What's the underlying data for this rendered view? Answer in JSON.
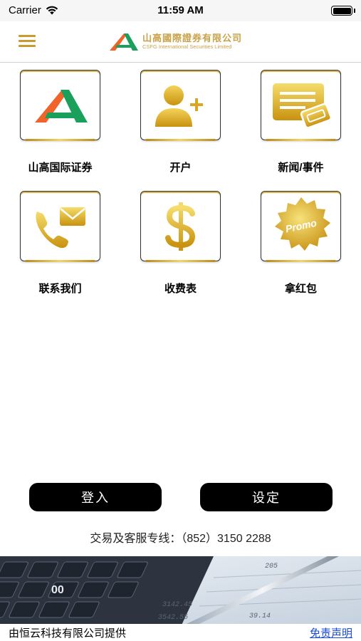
{
  "status_bar": {
    "carrier": "Carrier",
    "time": "11:59 AM"
  },
  "header": {
    "logo_cn": "山高國際證券有限公司",
    "logo_en": "CSFG International Securities Limited"
  },
  "tiles": [
    {
      "label": "山高国际证券",
      "icon": "csfg-logo-icon"
    },
    {
      "label": "开户",
      "icon": "add-user-icon"
    },
    {
      "label": "新闻/事件",
      "icon": "news-icon"
    },
    {
      "label": "联系我们",
      "icon": "contact-icon"
    },
    {
      "label": "收费表",
      "icon": "dollar-icon"
    },
    {
      "label": "拿红包",
      "icon": "promo-badge-icon",
      "badge_text": "Promo"
    }
  ],
  "buttons": {
    "login": "登入",
    "settings": "设定"
  },
  "hotline": "交易及客服专线：（852）3150 2288",
  "footer": {
    "provider": "由恒云科技有限公司提供",
    "disclaimer": "免责声明"
  },
  "banner_numbers": [
    "00",
    "205",
    "3142.45",
    "3542.55",
    "39.14"
  ],
  "colors": {
    "gold": "#d9a81f",
    "gold_light": "#f3d35a",
    "logo_green": "#1aa05a",
    "logo_orange": "#f0642a",
    "link_blue": "#1a4ad6"
  }
}
